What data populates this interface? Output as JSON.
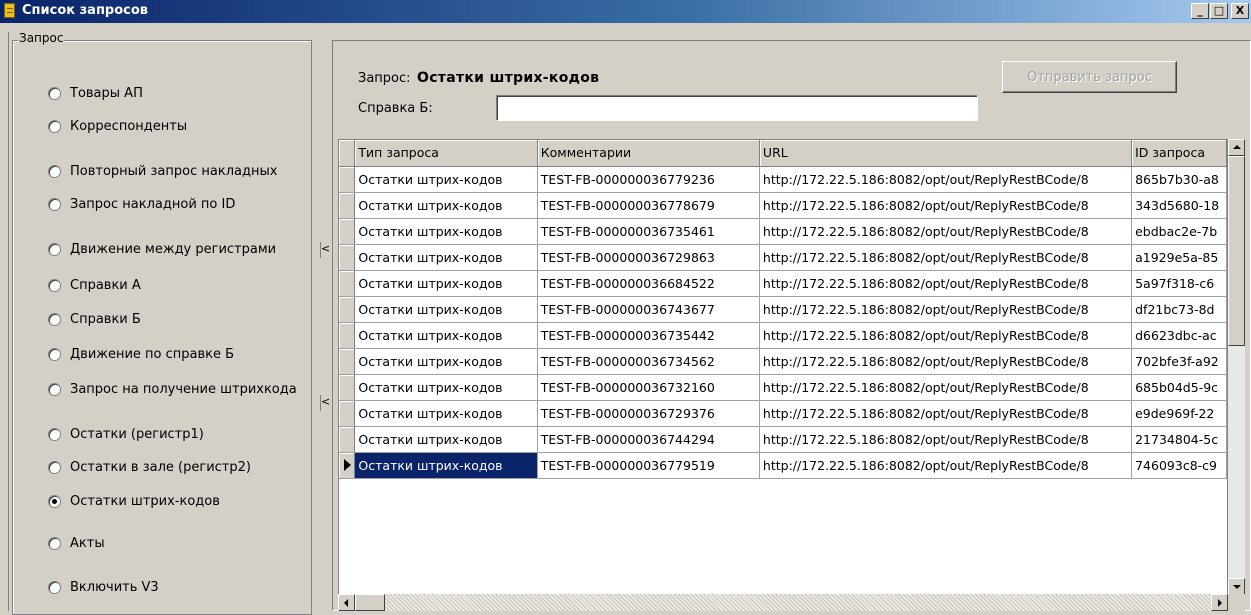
{
  "window": {
    "title": "Список запросов",
    "buttons": {
      "minimize": "_",
      "maximize": "□",
      "close": "X"
    }
  },
  "request_group": {
    "legend": "Запрос",
    "options": [
      {
        "label": "Товары АП",
        "selected": false
      },
      {
        "label": "Корреспонденты",
        "selected": false
      },
      {
        "label": "Повторный запрос накладных",
        "selected": false
      },
      {
        "label": "Запрос накладной по ID",
        "selected": false
      },
      {
        "label": "Движение между регистрами",
        "selected": false
      },
      {
        "label": "Справки А",
        "selected": false
      },
      {
        "label": "Справки Б",
        "selected": false
      },
      {
        "label": "Движение по справке Б",
        "selected": false
      },
      {
        "label": "Запрос на получение штрихкода",
        "selected": false
      },
      {
        "label": "Остатки (регистр1)",
        "selected": false
      },
      {
        "label": "Остатки в зале (регистр2)",
        "selected": false
      },
      {
        "label": "Остатки штрих-кодов",
        "selected": true
      },
      {
        "label": "Акты",
        "selected": false
      },
      {
        "label": "Включить V3",
        "selected": false
      }
    ]
  },
  "splitter": {
    "grip_top": "<",
    "grip_bottom": "<"
  },
  "header": {
    "request_label": "Запрос:",
    "request_value": "Остатки штрих-кодов",
    "spravka_label": "Справка Б:",
    "spravka_value": "",
    "send_button": "Отправить запрос"
  },
  "grid": {
    "columns": [
      "Тип запроса",
      "Комментарии",
      "URL",
      "ID запроса"
    ],
    "selected_row": 11,
    "rows": [
      [
        "Остатки штрих-кодов",
        "TEST-FB-000000036779236",
        "http://172.22.5.186:8082/opt/out/ReplyRestBCode/8",
        "865b7b30-a8"
      ],
      [
        "Остатки штрих-кодов",
        "TEST-FB-000000036778679",
        "http://172.22.5.186:8082/opt/out/ReplyRestBCode/8",
        "343d5680-18"
      ],
      [
        "Остатки штрих-кодов",
        "TEST-FB-000000036735461",
        "http://172.22.5.186:8082/opt/out/ReplyRestBCode/8",
        "ebdbac2e-7b"
      ],
      [
        "Остатки штрих-кодов",
        "TEST-FB-000000036729863",
        "http://172.22.5.186:8082/opt/out/ReplyRestBCode/8",
        "a1929e5a-85"
      ],
      [
        "Остатки штрих-кодов",
        "TEST-FB-000000036684522",
        "http://172.22.5.186:8082/opt/out/ReplyRestBCode/8",
        "5a97f318-c6"
      ],
      [
        "Остатки штрих-кодов",
        "TEST-FB-000000036743677",
        "http://172.22.5.186:8082/opt/out/ReplyRestBCode/8",
        "df21bc73-8d"
      ],
      [
        "Остатки штрих-кодов",
        "TEST-FB-000000036735442",
        "http://172.22.5.186:8082/opt/out/ReplyRestBCode/8",
        "d6623dbc-ac"
      ],
      [
        "Остатки штрих-кодов",
        "TEST-FB-000000036734562",
        "http://172.22.5.186:8082/opt/out/ReplyRestBCode/8",
        "702bfe3f-a92"
      ],
      [
        "Остатки штрих-кодов",
        "TEST-FB-000000036732160",
        "http://172.22.5.186:8082/opt/out/ReplyRestBCode/8",
        "685b04d5-9c"
      ],
      [
        "Остатки штрих-кодов",
        "TEST-FB-000000036729376",
        "http://172.22.5.186:8082/opt/out/ReplyRestBCode/8",
        "e9de969f-22"
      ],
      [
        "Остатки штрих-кодов",
        "TEST-FB-000000036744294",
        "http://172.22.5.186:8082/opt/out/ReplyRestBCode/8",
        "21734804-5c"
      ],
      [
        "Остатки штрих-кодов",
        "TEST-FB-000000036779519",
        "http://172.22.5.186:8082/opt/out/ReplyRestBCode/8",
        "746093c8-c9"
      ]
    ]
  },
  "colors": {
    "title_active": "#0a246a",
    "face": "#d4d0c8",
    "selection": "#0a246a"
  }
}
